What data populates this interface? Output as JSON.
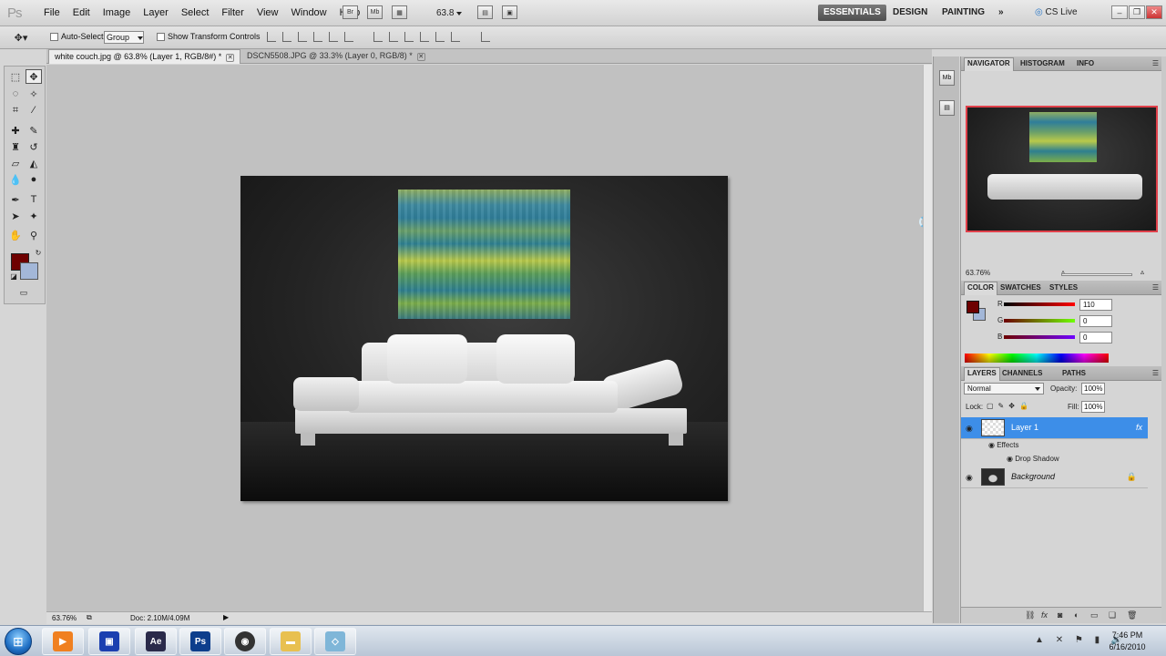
{
  "app": {
    "logo": "Ps"
  },
  "menu": [
    "File",
    "Edit",
    "Image",
    "Layer",
    "Select",
    "Filter",
    "View",
    "Window",
    "Help"
  ],
  "menubar_icons": {
    "bridge": "Br",
    "mini_bridge": "Mb"
  },
  "zoom_field": "63.8",
  "workspaces": {
    "essentials": "ESSENTIALS",
    "design": "DESIGN",
    "painting": "PAINTING",
    "more": "»",
    "cslive": "CS Live"
  },
  "options": {
    "auto_select_label": "Auto-Select:",
    "auto_select_value": "Group",
    "show_transform": "Show Transform Controls"
  },
  "doc_tabs": [
    {
      "title": "white couch.jpg @ 63.8% (Layer 1, RGB/8#) *"
    },
    {
      "title": "DSCN5508.JPG @ 33.3% (Layer 0, RGB/8) *"
    }
  ],
  "status": {
    "zoom": "63.76%",
    "doc": "Doc: 2.10M/4.09M"
  },
  "navigator": {
    "tabs": [
      "NAVIGATOR",
      "HISTOGRAM",
      "INFO"
    ],
    "zoom": "63.76%"
  },
  "color_panel": {
    "tabs": [
      "COLOR",
      "SWATCHES",
      "STYLES"
    ],
    "channels": [
      {
        "name": "R",
        "value": "110"
      },
      {
        "name": "G",
        "value": "0"
      },
      {
        "name": "B",
        "value": "0"
      }
    ],
    "fg_color": "#6e0000",
    "bg_color": "#a3b7d8"
  },
  "layers_panel": {
    "tabs": [
      "LAYERS",
      "CHANNELS",
      "PATHS"
    ],
    "blend_mode": "Normal",
    "opacity_label": "Opacity:",
    "opacity": "100%",
    "lock_label": "Lock:",
    "fill_label": "Fill:",
    "fill": "100%",
    "layers": [
      {
        "name": "Layer 1",
        "effects_label": "Effects",
        "effect": "Drop Shadow",
        "fx": "fx"
      },
      {
        "name": "Background"
      }
    ]
  },
  "taskbar": {
    "ae": "Ae",
    "ps": "Ps"
  },
  "clock": {
    "time": "7:46 PM",
    "date": "6/16/2010"
  }
}
